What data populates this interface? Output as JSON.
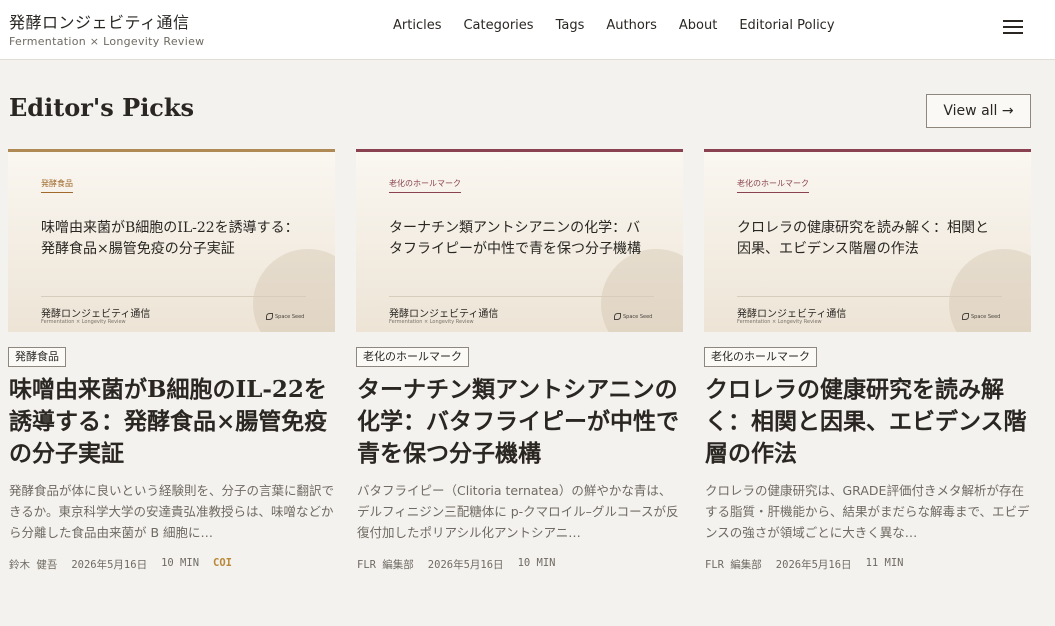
{
  "brand": {
    "title": "発酵ロンジェビティ通信",
    "subtitle": "Fermentation × Longevity Review"
  },
  "nav": [
    "Articles",
    "Categories",
    "Tags",
    "Authors",
    "About",
    "Editorial Policy"
  ],
  "section": {
    "title": "Editor's Picks",
    "view_all": "View all →"
  },
  "thumb_brand": {
    "title": "発酵ロンジェビティ通信",
    "subtitle": "Fermentation × Longevity Review",
    "logo": "Space Seed"
  },
  "cards": [
    {
      "category": "発酵食品",
      "thumb_title": "味噌由来菌がB細胞のIL-22を誘導する：発酵食品×腸管免疫の分子実証",
      "tag": "発酵食品",
      "title": "味噌由来菌がB細胞のIL-22を誘導する：発酵食品×腸管免疫の分子実証",
      "excerpt": "発酵食品が体に良いという経験則を、分子の言葉に翻訳できるか。東京科学大学の安達貴弘准教授らは、味噌などから分離した食品由来菌が B 細胞に…",
      "author": "鈴木 健吾",
      "date": "2026年5月16日",
      "read": "10 MIN",
      "badge": "COI"
    },
    {
      "category": "老化のホールマーク",
      "thumb_title": "ターナチン類アントシアニンの化学：バタフライピーが中性で青を保つ分子機構",
      "tag": "老化のホールマーク",
      "title": "ターナチン類アントシアニンの化学：バタフライピーが中性で青を保つ分子機構",
      "excerpt": "バタフライピー（Clitoria ternatea）の鮮やかな青は、デルフィニジン三配糖体に p-クマロイル–グルコースが反復付加したポリアシル化アントシアニ…",
      "author": "FLR 編集部",
      "date": "2026年5月16日",
      "read": "10 MIN",
      "badge": ""
    },
    {
      "category": "老化のホールマーク",
      "thumb_title": "クロレラの健康研究を読み解く：相関と因果、エビデンス階層の作法",
      "tag": "老化のホールマーク",
      "title": "クロレラの健康研究を読み解く：相関と因果、エビデンス階層の作法",
      "excerpt": "クロレラの健康研究は、GRADE評価付きメタ解析が存在する脂質・肝機能から、結果がまだらな解毒まで、エビデンスの強さが領域ごとに大きく異な…",
      "author": "FLR 編集部",
      "date": "2026年5月16日",
      "read": "11 MIN",
      "badge": ""
    }
  ]
}
